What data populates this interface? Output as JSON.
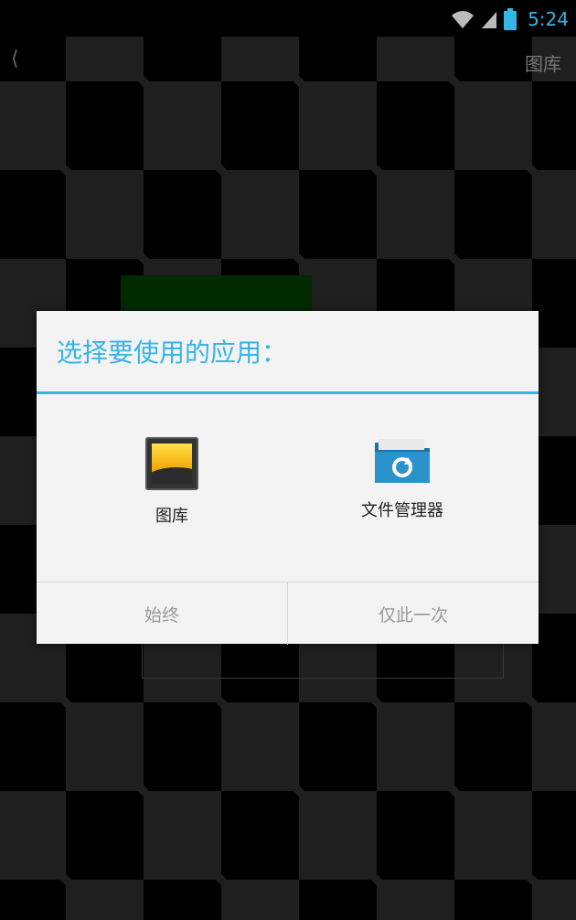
{
  "status_bar": {
    "time": "5:24",
    "icons": [
      "wifi-icon",
      "signal-icon",
      "battery-icon"
    ],
    "accent_color": "#33b5e5"
  },
  "app_bar": {
    "back_icon": "chevron-left-icon",
    "title_right": "图库"
  },
  "dialog": {
    "title": "选择要使用的应用：",
    "accent_color": "#33b5e5",
    "apps": [
      {
        "label": "图库",
        "icon": "gallery-icon"
      },
      {
        "label": "文件管理器",
        "icon": "folder-sync-icon"
      }
    ],
    "buttons": {
      "always": "始终",
      "just_once": "仅此一次"
    }
  }
}
